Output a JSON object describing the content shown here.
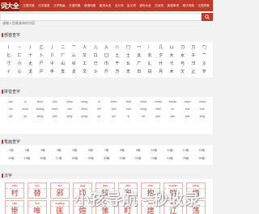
{
  "logo": "词大全",
  "nav": [
    "汉语字典",
    "汉字部首",
    "汉字笔画",
    "汉语词典",
    "成语词典",
    "组词大全",
    "近义词",
    "反义词",
    "造句大全",
    "古诗词",
    "英语单词",
    "现代词典",
    "汉语拼音"
  ],
  "search": {
    "placeholder": "请输入您要查询的内容"
  },
  "sections": {
    "radicals": "部首查字",
    "pinyin": "拼音查字",
    "strokes": "笔画查字",
    "chars": "汉字"
  },
  "radicals": [
    "丨",
    "丶",
    "丿",
    "乙",
    "亅",
    "二",
    "亠",
    "人",
    "儿",
    "入",
    "八",
    "冂",
    "冖",
    "冫",
    "几",
    "凵",
    "刀",
    "力",
    "勹",
    "匕",
    "匚",
    "十",
    "卜",
    "卩",
    "厂",
    "厶",
    "又",
    "口",
    "囗",
    "土",
    "士",
    "夂",
    "夊",
    "夕",
    "大",
    "女",
    "子",
    "宀",
    "寸",
    "小",
    "尢",
    "尸",
    "屮",
    "山",
    "巛",
    "工",
    "己",
    "巾",
    "干",
    "幺",
    "广",
    "廴",
    "廾",
    "弋",
    "弓",
    "彐",
    "彡",
    "彳",
    "心",
    "戈",
    "户",
    "手",
    "支",
    "攴",
    "文",
    "斗",
    "斤",
    "方",
    "无",
    "日",
    "曰",
    "月",
    "木",
    "欠",
    "止",
    "歹"
  ],
  "pinyin": [
    "cuo",
    "lv",
    "zhuo",
    "zhu",
    "zhou",
    "zong",
    "zi",
    "zhen",
    "zhei",
    "zhua",
    "zhuai",
    "zhuan",
    "zhuo",
    "zhua",
    "cei",
    "zhou",
    "zhang",
    "zhen",
    "zhe",
    "zhou",
    "zhi",
    "zha",
    "zao",
    "zeng",
    "zhei",
    "zu",
    "zuo",
    "zun",
    "ya",
    "ye",
    "yang",
    "yue",
    "ying",
    "yong",
    "yu",
    "yin",
    "yi",
    "ya",
    "you",
    "yao",
    "yan",
    "ying"
  ],
  "strokes": [
    "1画",
    "2画",
    "3画",
    "4画",
    "5画",
    "6画",
    "7画",
    "8画",
    "9画",
    "10画",
    "11画",
    "12画",
    "13画",
    "14画",
    "15画",
    "16画",
    "17画",
    "18画",
    "19画",
    "20画",
    "21画",
    "22画",
    "23画",
    "24画",
    "25画",
    "26画"
  ],
  "char_cards": [
    {
      "py": "cūn",
      "ch": "村"
    },
    {
      "py": "cuì",
      "ch": "替"
    },
    {
      "py": "zhì",
      "ch": "邪"
    },
    {
      "py": "jìng",
      "ch": "顷"
    },
    {
      "py": "jiào",
      "ch": "铰"
    },
    {
      "py": "dōu",
      "ch": "兜"
    },
    {
      "py": "bào",
      "ch": "抱"
    },
    {
      "py": "chuǎn",
      "ch": "喘"
    },
    {
      "py": "bǐng",
      "ch": "炳"
    },
    {
      "py": "cǎn",
      "ch": "惨"
    },
    {
      "py": "huí",
      "ch": "唯"
    },
    {
      "py": "kuǎng",
      "ch": "匡"
    },
    {
      "py": "jiě",
      "ch": "媗"
    },
    {
      "py": "sù",
      "ch": "愫"
    },
    {
      "py": "dīng",
      "ch": "盯"
    },
    {
      "py": "jiàn",
      "ch": "建"
    },
    {
      "py": "liáo",
      "ch": "辽"
    },
    {
      "py": "fěi",
      "ch": "荡"
    }
  ],
  "watermark": "小孩导航 - 秒收录",
  "colors": {
    "accent": "#c0392b",
    "background": "#f2f2f2"
  }
}
